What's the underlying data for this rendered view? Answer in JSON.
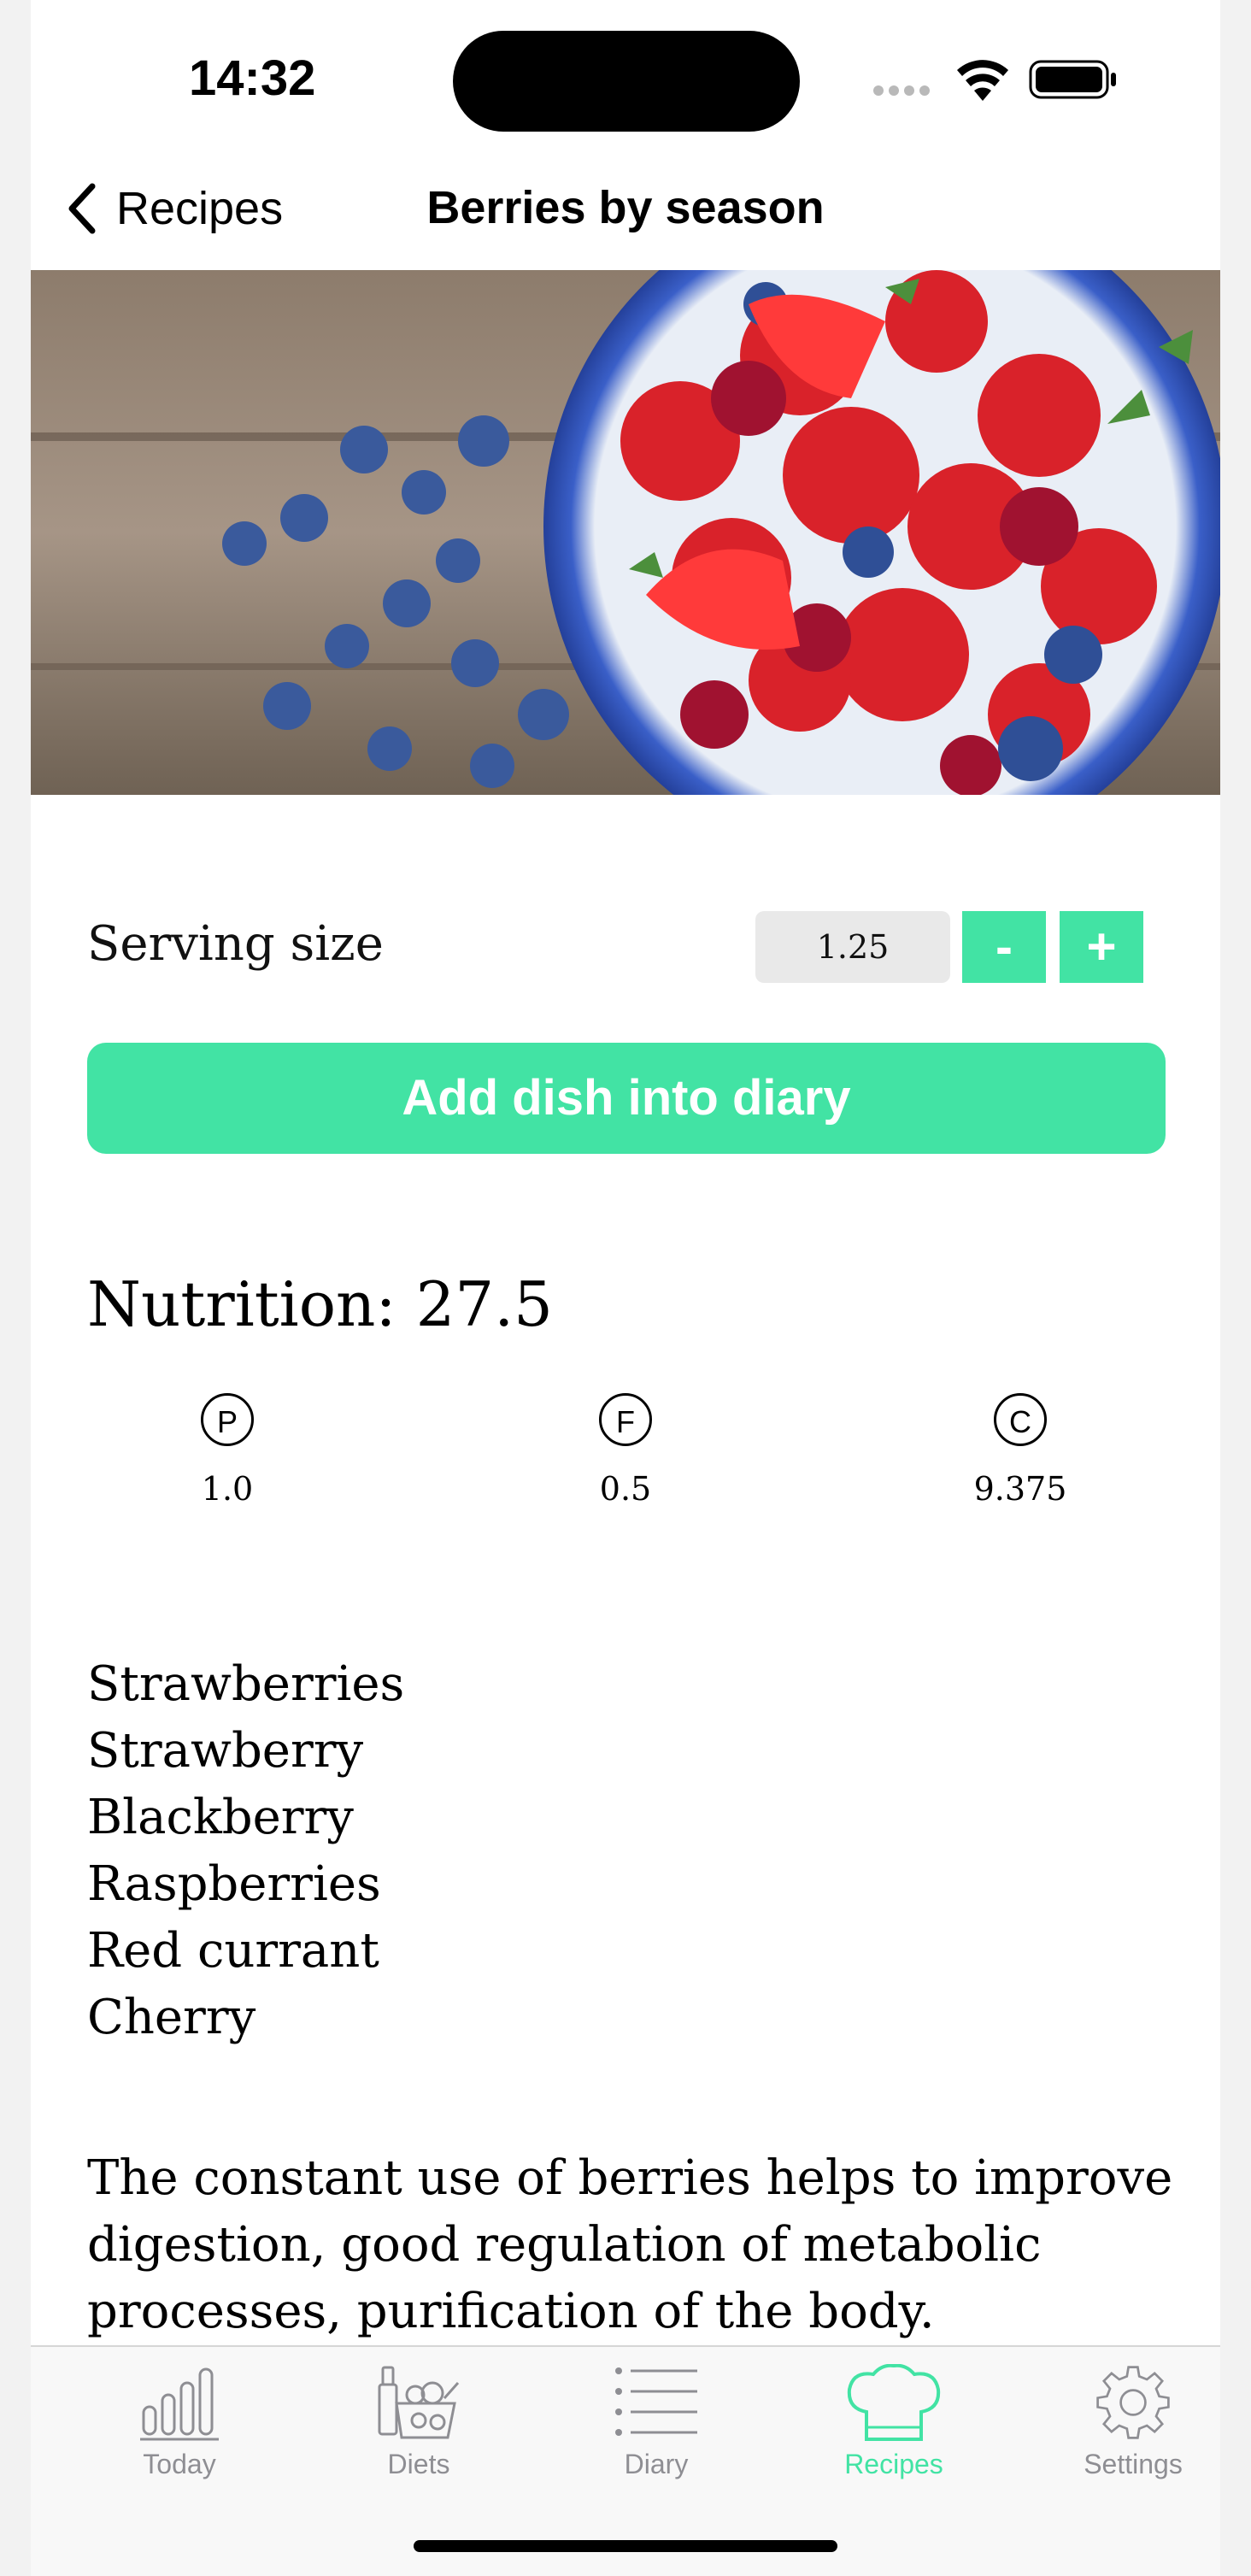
{
  "status_bar": {
    "time": "14:32"
  },
  "nav": {
    "back_label": "Recipes",
    "title": "Berries by season"
  },
  "serving": {
    "label": "Serving size",
    "value": "1.25",
    "minus": "-",
    "plus": "+"
  },
  "add_button": "Add dish into diary",
  "nutrition": {
    "title": "Nutrition: 27.5",
    "macros": [
      {
        "letter": "P",
        "value": "1.0"
      },
      {
        "letter": "F",
        "value": "0.5"
      },
      {
        "letter": "C",
        "value": "9.375"
      }
    ]
  },
  "ingredients": [
    "Strawberries",
    "Strawberry",
    "Blackberry",
    "Raspberries",
    "Red currant",
    "Cherry"
  ],
  "description": "The constant use of berries helps to improve digestion, good regulation of metabolic processes, purification of the body.",
  "tabs": [
    {
      "label": "Today",
      "icon": "bar-chart-icon"
    },
    {
      "label": "Diets",
      "icon": "groceries-icon"
    },
    {
      "label": "Diary",
      "icon": "list-icon"
    },
    {
      "label": "Recipes",
      "icon": "chef-hat-icon",
      "active": true
    },
    {
      "label": "Settings",
      "icon": "gear-icon"
    }
  ],
  "colors": {
    "accent": "#42e3a4",
    "tab_inactive": "#8e8e93"
  }
}
